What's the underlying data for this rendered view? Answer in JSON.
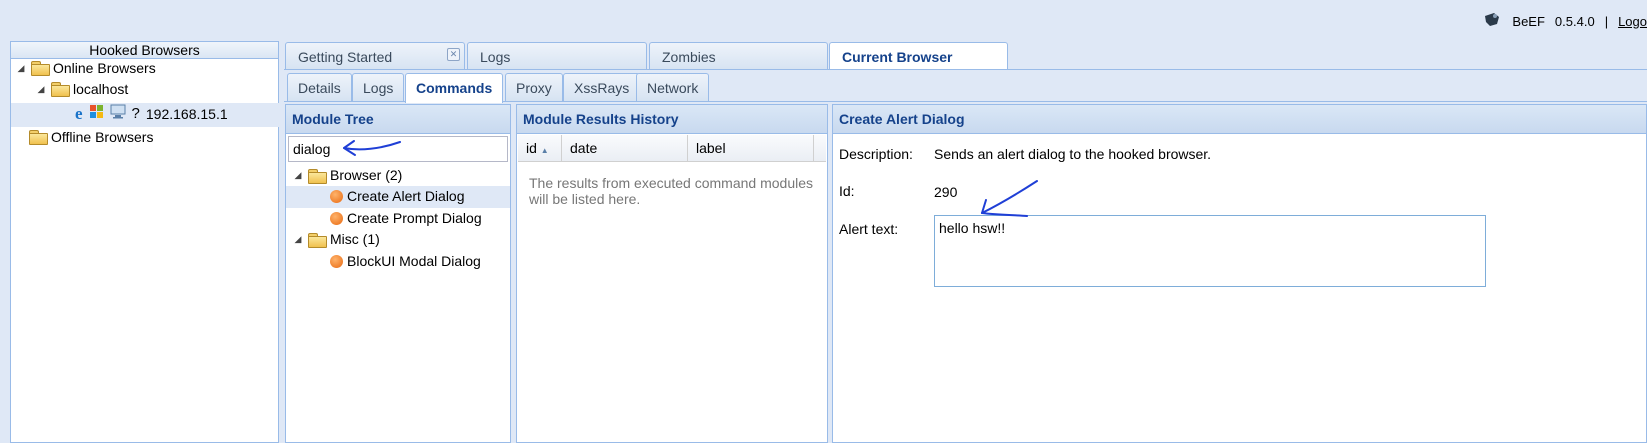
{
  "topbar": {
    "app_name": "BeEF",
    "version": "0.5.4.0",
    "separator": "|",
    "logout_label": "Logo"
  },
  "left_panel": {
    "title": "Hooked Browsers",
    "online_label": "Online Browsers",
    "host_label": "localhost",
    "browser_ip": "192.168.15.1",
    "offline_label": "Offline Browsers",
    "browser_icons": [
      "ie-icon",
      "windows-icon",
      "computer-icon",
      "unknown-icon"
    ]
  },
  "main_tabs": [
    {
      "label": "Getting Started",
      "closable": true
    },
    {
      "label": "Logs"
    },
    {
      "label": "Zombies"
    },
    {
      "label": "Current Browser",
      "active": true
    }
  ],
  "sub_tabs": [
    "Details",
    "Logs",
    "Commands",
    "Proxy",
    "XssRays",
    "Network"
  ],
  "active_sub_tab": "Commands",
  "module_tree": {
    "title": "Module Tree",
    "search_value": "dialog",
    "groups": [
      {
        "label": "Browser (2)",
        "items": [
          "Create Alert Dialog",
          "Create Prompt Dialog"
        ]
      },
      {
        "label": "Misc (1)",
        "items": [
          "BlockUI Modal Dialog"
        ]
      }
    ],
    "selected": "Create Alert Dialog"
  },
  "results": {
    "title": "Module Results History",
    "columns": [
      "id",
      "date",
      "label"
    ],
    "empty_text": "The results from executed command modules will be listed here."
  },
  "detail": {
    "title": "Create Alert Dialog",
    "description_label": "Description:",
    "description_value": "Sends an alert dialog to the hooked browser.",
    "id_label": "Id:",
    "id_value": "290",
    "alert_label": "Alert text:",
    "alert_value": "hello hsw!!"
  },
  "colors": {
    "header_text": "#15428b",
    "border": "#99bbe8",
    "background": "#dfe8f6",
    "annotation": "#1f3fd6"
  }
}
